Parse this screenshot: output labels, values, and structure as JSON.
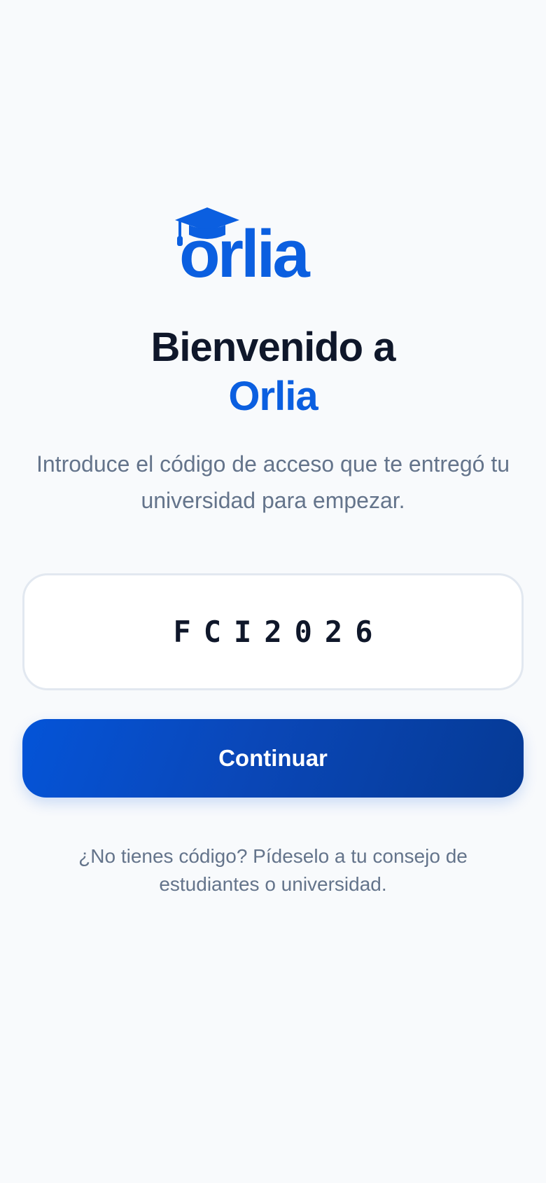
{
  "brand": {
    "name": "Orlia",
    "logo_text": "orlia",
    "logo_icon": "graduation-cap-icon",
    "primary_color": "#0b5fe0"
  },
  "welcome": {
    "title_prefix": "Bienvenido a",
    "title_brand": "Orlia",
    "subtitle": "Introduce el código de acceso que te entregó tu universidad para empezar."
  },
  "access_code": {
    "value": "FCI2026"
  },
  "actions": {
    "continue_label": "Continuar"
  },
  "help": {
    "text": "¿No tienes código? Pídeselo a tu consejo de estudiantes o universidad."
  }
}
